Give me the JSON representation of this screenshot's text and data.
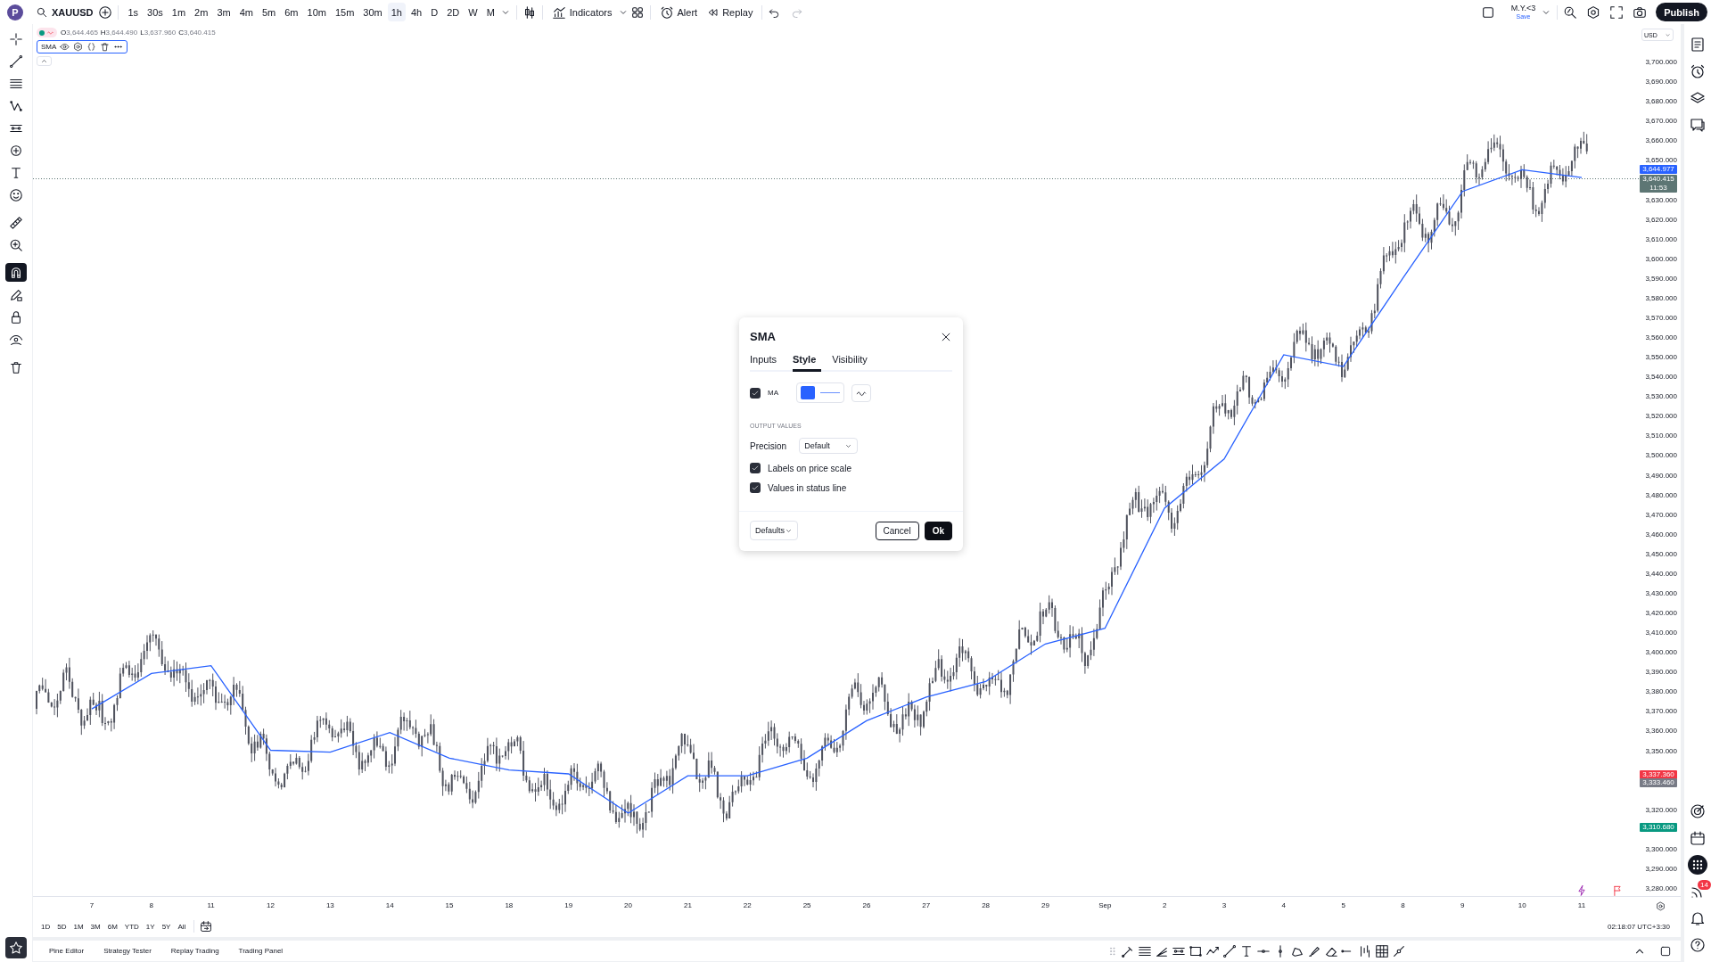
{
  "topbar": {
    "logo": "P",
    "symbol": "XAUUSD",
    "intervals": [
      {
        "label": "1s",
        "selected": false
      },
      {
        "label": "30s",
        "selected": false
      },
      {
        "label": "1m",
        "selected": false
      },
      {
        "label": "2m",
        "selected": false
      },
      {
        "label": "3m",
        "selected": false
      },
      {
        "label": "4m",
        "selected": false
      },
      {
        "label": "5m",
        "selected": false
      },
      {
        "label": "6m",
        "selected": false
      },
      {
        "label": "10m",
        "selected": false
      },
      {
        "label": "15m",
        "selected": false
      },
      {
        "label": "30m",
        "selected": false
      },
      {
        "label": "1h",
        "selected": true
      },
      {
        "label": "4h",
        "selected": false
      },
      {
        "label": "D",
        "selected": false
      },
      {
        "label": "2D",
        "selected": false
      },
      {
        "label": "W",
        "selected": false
      },
      {
        "label": "M",
        "selected": false
      }
    ],
    "indicators": "Indicators",
    "alert": "Alert",
    "replay": "Replay",
    "layout_name": "M.Y.<3",
    "layout_status": "Save",
    "publish": "Publish"
  },
  "magnet_mode": {
    "on": true
  },
  "legend": {
    "ohlc": [
      {
        "key": "O",
        "value": "3,644.465"
      },
      {
        "key": "H",
        "value": "3,644.490"
      },
      {
        "key": "L",
        "value": "3,637.960"
      },
      {
        "key": "C",
        "value": "3,640.415"
      }
    ],
    "study": "SMA"
  },
  "price_scale": {
    "currency": "USD",
    "tags": [
      {
        "kind": "indicator",
        "label": "3,644.977",
        "color": "#2962ff"
      },
      {
        "kind": "last_price",
        "label": "3,640.415",
        "sublabel": "11:53",
        "color": "#5d7674"
      },
      {
        "kind": "marker",
        "label": "3,337.360",
        "color": "#f23645"
      },
      {
        "kind": "marker",
        "label": "3,333.460",
        "color": "#787b86"
      },
      {
        "kind": "marker",
        "label": "3,310.680",
        "color": "#089981"
      }
    ]
  },
  "chart": {
    "chart_data": {
      "type": "line",
      "categories": [
        "7",
        "8",
        "11",
        "12",
        "13",
        "14",
        "15",
        "18",
        "19",
        "20",
        "21",
        "22",
        "25",
        "26",
        "27",
        "28",
        "29",
        "Sep",
        "2",
        "3",
        "4",
        "5",
        "8",
        "9",
        "10",
        "11"
      ],
      "series": [
        {
          "color": "#2962ff",
          "values": [
            3371,
            3389,
            3393,
            3350,
            3349,
            3359,
            3346,
            3340,
            3338,
            3318,
            3337,
            3337,
            3346,
            3365,
            3377,
            3385,
            3404,
            3412,
            3473,
            3498,
            3551,
            3545,
            3590,
            3634,
            3645,
            3641
          ]
        }
      ],
      "yticks": [
        {
          "value": 3700,
          "label": "3,700.000"
        },
        {
          "value": 3690,
          "label": "3,690.000"
        },
        {
          "value": 3680,
          "label": "3,680.000"
        },
        {
          "value": 3670,
          "label": "3,670.000"
        },
        {
          "value": 3660,
          "label": "3,660.000"
        },
        {
          "value": 3650,
          "label": "3,650.000"
        },
        {
          "value": 3630,
          "label": "3,630.000"
        },
        {
          "value": 3620,
          "label": "3,620.000"
        },
        {
          "value": 3610,
          "label": "3,610.000"
        },
        {
          "value": 3600,
          "label": "3,600.000"
        },
        {
          "value": 3590,
          "label": "3,590.000"
        },
        {
          "value": 3580,
          "label": "3,580.000"
        },
        {
          "value": 3570,
          "label": "3,570.000"
        },
        {
          "value": 3560,
          "label": "3,560.000"
        },
        {
          "value": 3550,
          "label": "3,550.000"
        },
        {
          "value": 3540,
          "label": "3,540.000"
        },
        {
          "value": 3530,
          "label": "3,530.000"
        },
        {
          "value": 3520,
          "label": "3,520.000"
        },
        {
          "value": 3510,
          "label": "3,510.000"
        },
        {
          "value": 3500,
          "label": "3,500.000"
        },
        {
          "value": 3490,
          "label": "3,490.000"
        },
        {
          "value": 3480,
          "label": "3,480.000"
        },
        {
          "value": 3470,
          "label": "3,470.000"
        },
        {
          "value": 3460,
          "label": "3,460.000"
        },
        {
          "value": 3450,
          "label": "3,450.000"
        },
        {
          "value": 3440,
          "label": "3,440.000"
        },
        {
          "value": 3430,
          "label": "3,430.000"
        },
        {
          "value": 3420,
          "label": "3,420.000"
        },
        {
          "value": 3410,
          "label": "3,410.000"
        },
        {
          "value": 3400,
          "label": "3,400.000"
        },
        {
          "value": 3390,
          "label": "3,390.000"
        },
        {
          "value": 3380,
          "label": "3,380.000"
        },
        {
          "value": 3370,
          "label": "3,370.000"
        },
        {
          "value": 3360,
          "label": "3,360.000"
        },
        {
          "value": 3350,
          "label": "3,350.000"
        },
        {
          "value": 3320,
          "label": "3,320.000"
        },
        {
          "value": 3300,
          "label": "3,300.000"
        },
        {
          "value": 3290,
          "label": "3,290.000"
        },
        {
          "value": 3280,
          "label": "3,280.000"
        }
      ],
      "ylim": [
        3280,
        3700
      ]
    }
  },
  "range_buttons": [
    "1D",
    "5D",
    "1M",
    "3M",
    "6M",
    "YTD",
    "1Y",
    "5Y",
    "All"
  ],
  "clock": "02:18:07 UTC+3:30",
  "bottom_tabs": [
    "Pine Editor",
    "Strategy Tester",
    "Replay Trading",
    "Trading Panel"
  ],
  "right_bar": {
    "notification_count": "14"
  },
  "dialog": {
    "title": "SMA",
    "tabs": [
      {
        "label": "Inputs",
        "selected": false
      },
      {
        "label": "Style",
        "selected": true
      },
      {
        "label": "Visibility",
        "selected": false
      }
    ],
    "plot": {
      "label": "MA",
      "checked": true,
      "color": "#2962ff"
    },
    "section": "OUTPUT VALUES",
    "precision": {
      "label": "Precision",
      "value": "Default"
    },
    "options": [
      {
        "label": "Labels on price scale",
        "checked": true
      },
      {
        "label": "Values in status line",
        "checked": true
      }
    ],
    "defaults": "Defaults",
    "cancel": "Cancel",
    "ok": "Ok"
  }
}
